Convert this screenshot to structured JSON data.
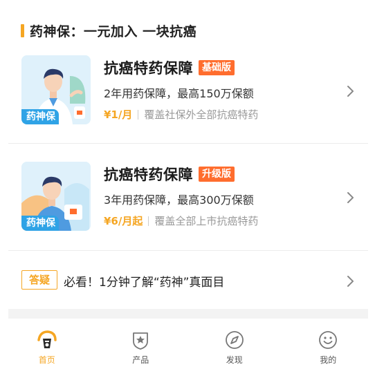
{
  "section": {
    "title": "药神保：一元加入 一块抗癌"
  },
  "products": [
    {
      "thumb_label": "药神保",
      "title": "抗癌特药保障",
      "badge": "基础版",
      "subtitle": "2年用药保障，最高150万保额",
      "price": "¥1/月",
      "price_desc": "覆盖社保外全部抗癌特药"
    },
    {
      "thumb_label": "药神保",
      "title": "抗癌特药保障",
      "badge": "升级版",
      "subtitle": "3年用药保障，最高300万保额",
      "price": "¥6/月起",
      "price_desc": "覆盖全部上市抗癌特药"
    }
  ],
  "faq": {
    "tag": "答疑",
    "text": "必看！1分钟了解“药神”真面目"
  },
  "tabbar": {
    "items": [
      {
        "label": "首页",
        "icon": "home-icon",
        "active": true
      },
      {
        "label": "产品",
        "icon": "shield-star-icon",
        "active": false
      },
      {
        "label": "发现",
        "icon": "compass-icon",
        "active": false
      },
      {
        "label": "我的",
        "icon": "smiley-icon",
        "active": false
      }
    ]
  },
  "colors": {
    "accent": "#f5a623",
    "badge": "#ff6d2e",
    "thumb_label": "#2fa3e6"
  }
}
